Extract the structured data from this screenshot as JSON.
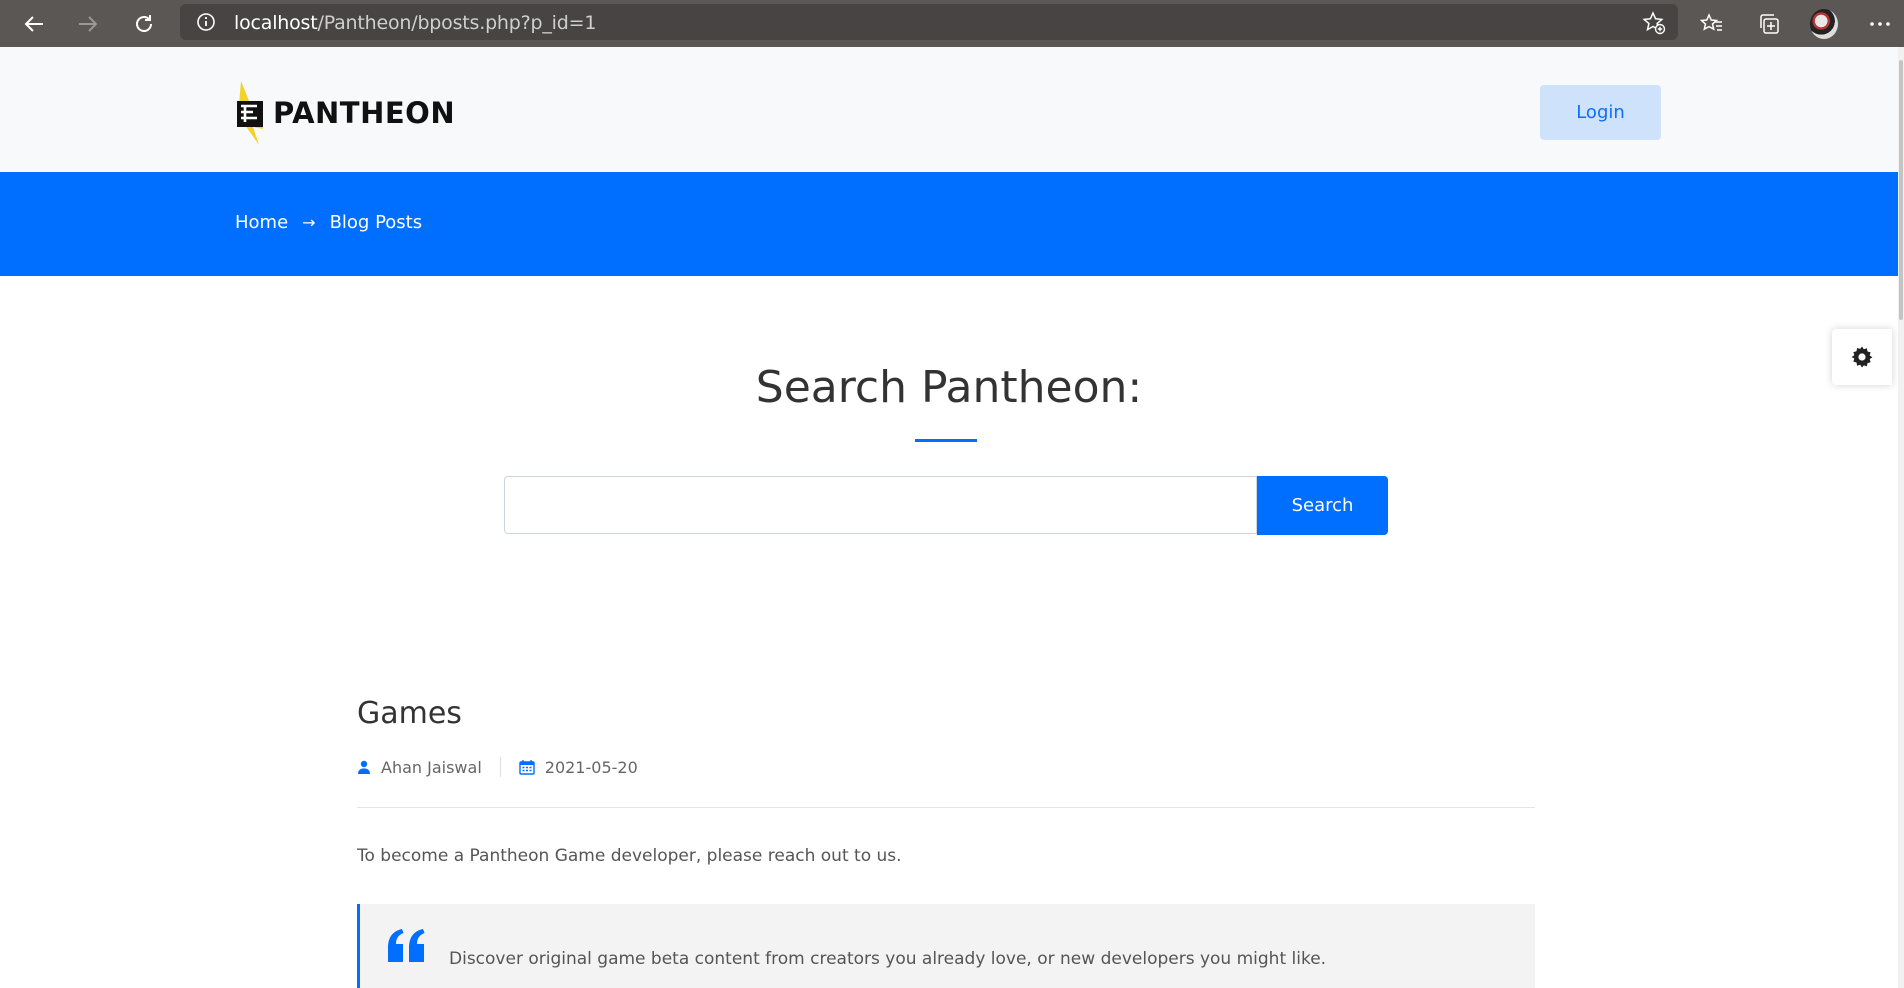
{
  "browser": {
    "url_host": "localhost",
    "url_path": "/Pantheon/bposts.php?p_id=1"
  },
  "header": {
    "logo_text": "PANTHEON",
    "login_label": "Login"
  },
  "breadcrumb": {
    "home": "Home",
    "arrow": "→",
    "current": "Blog Posts"
  },
  "search": {
    "title": "Search Pantheon:",
    "input_value": "",
    "button_label": "Search"
  },
  "post": {
    "title": "Games",
    "author": "Ahan Jaiswal",
    "date": "2021-05-20",
    "body": "To become a Pantheon Game developer, please reach out to us.",
    "quote": "Discover original game beta content from creators you already love, or new developers you might like."
  },
  "colors": {
    "accent": "#006eff",
    "login_bg": "#cfe2fb",
    "chrome": "#5b5755"
  }
}
